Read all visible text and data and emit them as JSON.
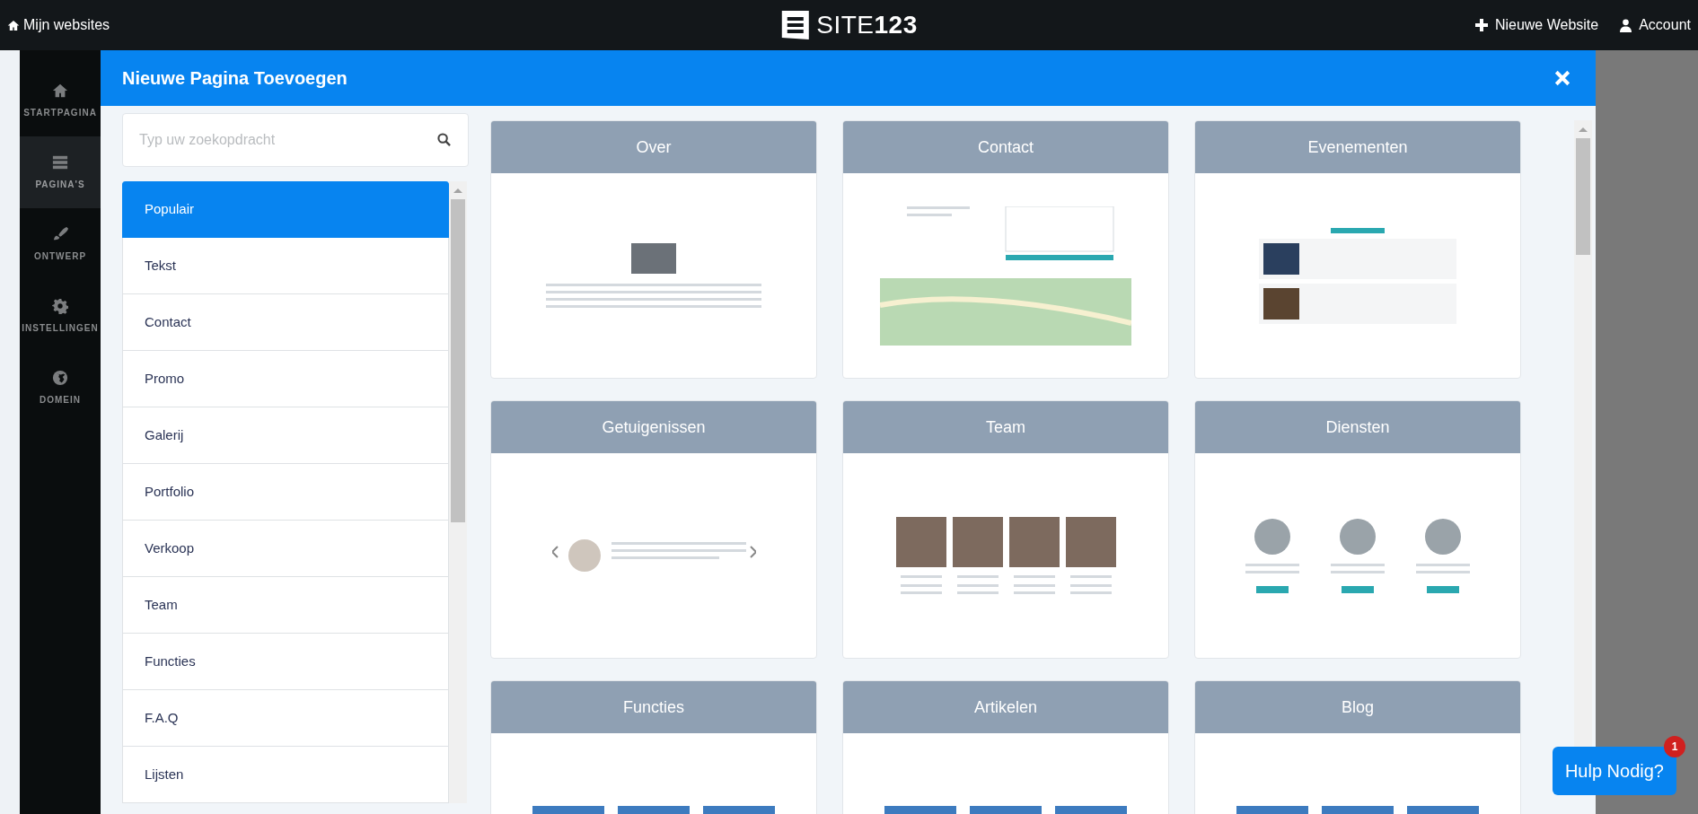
{
  "topbar": {
    "back_link": "Mijn websites",
    "logo": "SITE**123**",
    "new_website": "Nieuwe Website",
    "account": "Account"
  },
  "sidebar": {
    "items": [
      {
        "label": "STARTPAGINA",
        "selected": false
      },
      {
        "label": "PAGINA'S",
        "selected": true
      },
      {
        "label": "ONTWERP",
        "selected": false
      },
      {
        "label": "INSTELLINGEN",
        "selected": false
      },
      {
        "label": "DOMEIN",
        "selected": false
      }
    ]
  },
  "modal": {
    "title": "Nieuwe Pagina Toevoegen",
    "search": {
      "placeholder": "Typ uw zoekopdracht"
    },
    "categories": [
      {
        "label": "Populair",
        "selected": true
      },
      {
        "label": "Tekst",
        "selected": false
      },
      {
        "label": "Contact",
        "selected": false
      },
      {
        "label": "Promo",
        "selected": false
      },
      {
        "label": "Galerij",
        "selected": false
      },
      {
        "label": "Portfolio",
        "selected": false
      },
      {
        "label": "Verkoop",
        "selected": false
      },
      {
        "label": "Team",
        "selected": false
      },
      {
        "label": "Functies",
        "selected": false
      },
      {
        "label": "F.A.Q",
        "selected": false
      },
      {
        "label": "Lijsten",
        "selected": false
      }
    ],
    "templates": [
      {
        "title": "Over",
        "kind": "about"
      },
      {
        "title": "Contact",
        "kind": "contact"
      },
      {
        "title": "Evenementen",
        "kind": "events"
      },
      {
        "title": "Getuigenissen",
        "kind": "testimonials"
      },
      {
        "title": "Team",
        "kind": "team"
      },
      {
        "title": "Diensten",
        "kind": "services"
      },
      {
        "title": "Functies",
        "kind": "features"
      },
      {
        "title": "Artikelen",
        "kind": "articles"
      },
      {
        "title": "Blog",
        "kind": "blog"
      }
    ]
  },
  "help": {
    "label": "Hulp Nodig?",
    "badge": "1"
  }
}
